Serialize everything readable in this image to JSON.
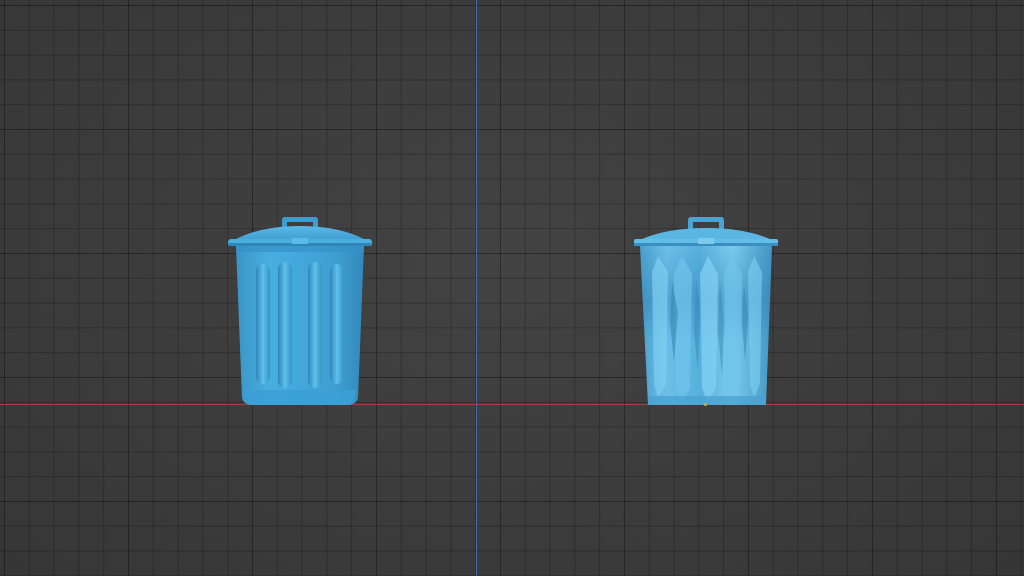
{
  "viewport": {
    "view_mode": "orthographic-front",
    "grid": true
  },
  "colors": {
    "background": "#3d3d3d",
    "grid_line": "#353535",
    "axis_x": "#a04040",
    "axis_z": "#3d6fa8",
    "object_body": "#3fa3d6",
    "object_highlight": "#7fcaf0",
    "object_shadow": "#2a7fb0",
    "origin_marker": "#c8b34a"
  },
  "objects": [
    {
      "name": "trash-can",
      "shading": "smooth"
    },
    {
      "name": "trash-can-faceted",
      "shading": "rough"
    }
  ]
}
